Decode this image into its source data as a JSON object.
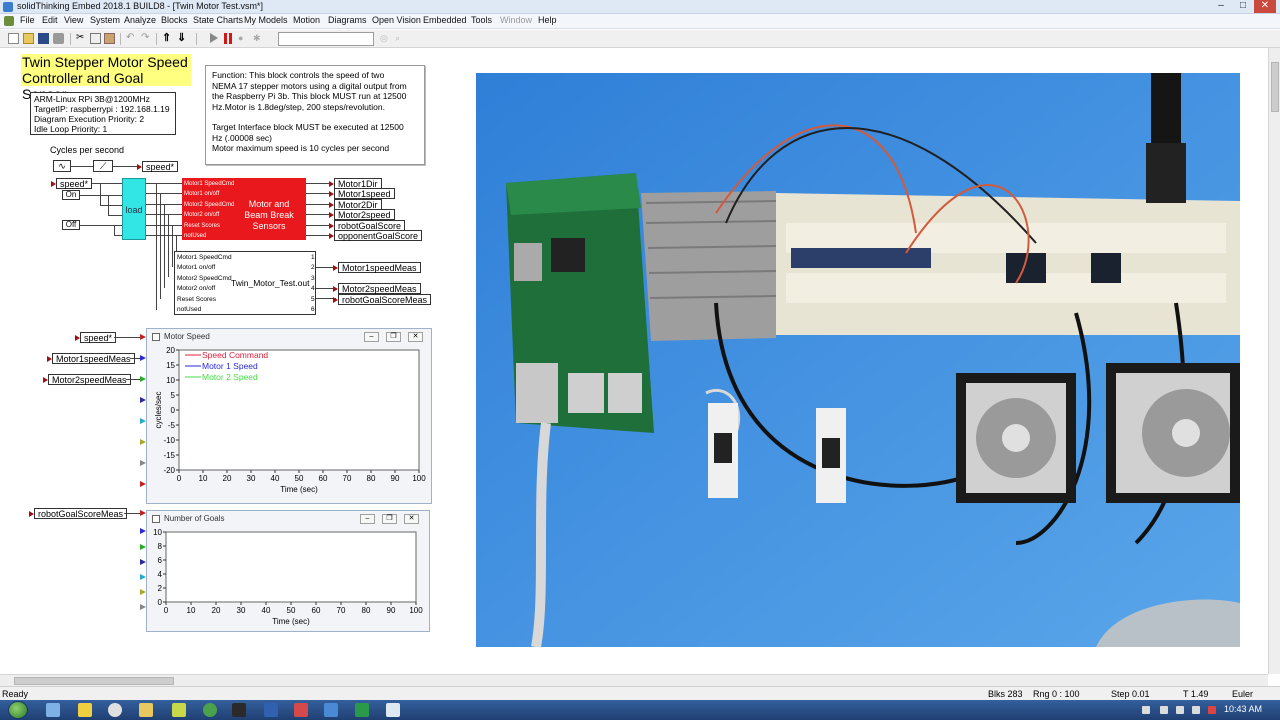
{
  "window": {
    "title": "solidThinking Embed 2018.1 BUILD8 - [Twin Motor Test.vsm*]",
    "min": "–",
    "max": "□",
    "close": "✕"
  },
  "menu": [
    "File",
    "Edit",
    "View",
    "System",
    "Analyze",
    "Blocks",
    "State Charts",
    "My Models",
    "Motion",
    "Diagrams",
    "Open Vision",
    "Embedded",
    "Tools",
    "Window",
    "Help"
  ],
  "diagram": {
    "title": "Twin Stepper Motor Speed Controller and Goal Sensor",
    "title_line1": "Twin Stepper Motor Speed",
    "title_line2": "Controller and Goal Sensor",
    "target_info": [
      "ARM-Linux RPi 3B@1200MHz",
      "TargetIP: raspberrypi : 192.168.1.19",
      "Diagram Execution Priority: 2",
      "Idle Loop Priority: 1"
    ],
    "description": [
      "Function:  This block controls the speed of two",
      "NEMA 17 stepper motors using a digital output from",
      "the Raspberry Pi 3b. This block MUST run at 12500",
      "Hz.Motor is 1.8deg/step, 200 steps/revolution.",
      "",
      "Target Interface block MUST be executed at 12500",
      "Hz (.00008 sec)",
      "Motor maximum speed is 10 cycles per second"
    ],
    "cycles_label": "Cycles per second",
    "speed_label": "speed*",
    "speed_in": "speed*",
    "on_label": "On",
    "off_label": "Off",
    "load_label": "load",
    "red_block": {
      "title": "Motor and Beam Break Sensors",
      "ports": [
        "Motor1 SpeedCmd",
        "Motor1 on/off",
        "Motor2 SpeedCmd",
        "Motor2 on/off",
        "Reset Scores",
        "notUsed"
      ]
    },
    "red_outputs": [
      "Motor1Dir",
      "Motor1speed",
      "Motor2Dir",
      "Motor2speed",
      "robotGoalScore",
      "opponentGoalScore"
    ],
    "out_block": {
      "title": "Twin_Motor_Test.out",
      "ports": [
        "Motor1 SpeedCmd",
        "Motor1 on/off",
        "Motor2 SpeedCmd",
        "Motor2 on/off",
        "Reset Scores",
        "notUsed"
      ],
      "port_nums": [
        "1",
        "2",
        "3",
        "4",
        "5",
        "6"
      ]
    },
    "out_outputs": [
      "Motor1speedMeas",
      "Motor2speedMeas",
      "robotGoalScoreMeas"
    ],
    "plot_inputs": [
      "speed*",
      "Motor1speedMeas",
      "Motor2speedMeas"
    ],
    "goal_input": "robotGoalScoreMeas"
  },
  "plot_speed": {
    "window_title": "Motor Speed",
    "chart_data": {
      "type": "line",
      "ylabel": "cycles/sec",
      "xlabel": "Time (sec)",
      "xlim": [
        0,
        100
      ],
      "ylim": [
        -20,
        20
      ],
      "xticks": [
        "0",
        "10",
        "20",
        "30",
        "40",
        "50",
        "60",
        "70",
        "80",
        "90",
        "100"
      ],
      "yticks": [
        "20",
        "15",
        "10",
        "5",
        "0",
        "-5",
        "-10",
        "-15",
        "-20"
      ],
      "series": [
        {
          "name": "Speed Command",
          "color": "#e0203a",
          "x": [
            0,
            0.3
          ],
          "y": [
            10,
            10
          ]
        },
        {
          "name": "Motor 1 Speed",
          "color": "#2a2ae0",
          "x": [
            0,
            0.3
          ],
          "y": [
            10,
            10
          ]
        },
        {
          "name": "Motor 2 Speed",
          "color": "#44dd44",
          "x": [
            0,
            0.3
          ],
          "y": [
            10,
            10
          ]
        }
      ]
    }
  },
  "plot_goals": {
    "window_title": "Number of Goals",
    "chart_data": {
      "type": "line",
      "xlabel": "Time (sec)",
      "xlim": [
        0,
        100
      ],
      "ylim": [
        0,
        10
      ],
      "xticks": [
        "0",
        "10",
        "20",
        "30",
        "40",
        "50",
        "60",
        "70",
        "80",
        "90",
        "100"
      ],
      "yticks": [
        "10",
        "8",
        "6",
        "4",
        "2",
        "0"
      ],
      "series": []
    }
  },
  "video": {
    "description_icon": "raspberry-pi-camera-feed"
  },
  "status": {
    "ready": "Ready",
    "blks": "Blks  283",
    "rng": "Rng  0 : 100",
    "step": "Step  0.01",
    "t": "T  1.49",
    "solver": "Euler"
  },
  "taskbar": {
    "clock": "10:43 AM"
  },
  "colors": {
    "title_bg": "#ffff80",
    "red_block": "#e8181c",
    "load_block": "#33e6e6",
    "video_blue": "#3a8fe0"
  }
}
